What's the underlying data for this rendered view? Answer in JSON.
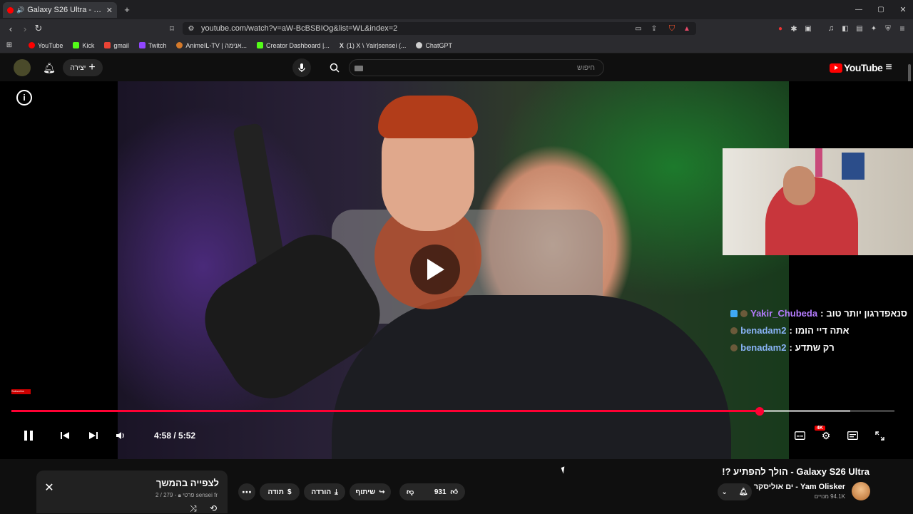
{
  "browser": {
    "tab_title": "Galaxy S26 Ultra - הולך להפתיע ?!",
    "url": "youtube.com/watch?v=aW-BcBSBIOg&list=WL&index=2",
    "bookmarks": [
      {
        "label": "YouTube",
        "color": "#ff0000"
      },
      {
        "label": "Kick",
        "color": "#53fc18"
      },
      {
        "label": "gmail",
        "color": "#ea4335"
      },
      {
        "label": "Twitch",
        "color": "#9146ff"
      },
      {
        "label": "AnimeIL-TV | אנימה...",
        "color": "#d4792a"
      },
      {
        "label": "Creator Dashboard |...",
        "color": "#53fc18"
      },
      {
        "label": "(1) X \\ Yair|sensei (...",
        "color": "#000000"
      },
      {
        "label": "ChatGPT",
        "color": "#cfcfcf"
      }
    ]
  },
  "youtube": {
    "create_label": "יצירה",
    "search_placeholder": "חיפוש",
    "logo_text": "YouTube",
    "logo_color": "#ff0000"
  },
  "player": {
    "current_time": "4:58",
    "duration": "5:52",
    "time_display": "4:58 / 5:52",
    "progress_fraction": 0.847,
    "loaded_fraction": 0.95,
    "quality_badge": "4K",
    "subscribe_tag": "Subscribe",
    "accent_color": "#ff0033"
  },
  "chat": [
    {
      "user": "Yakir_Chubeda",
      "message": "סנאפדרגון יותר טוב",
      "user_color": "#b57cff",
      "badge": "blue"
    },
    {
      "user": "benadam2",
      "message": "אתה דיי הומו",
      "user_color": "#8ab4f8",
      "badge": "gold"
    },
    {
      "user": "benadam2",
      "message": "רק שתדע",
      "user_color": "#8ab4f8",
      "badge": "gold"
    }
  ],
  "video_info": {
    "title": "Galaxy S26 Ultra - הולך להפתיע ?!",
    "channel": "Yam Olisker - ים אוליסקר",
    "subscribers": "94.1K מנויים",
    "likes": "931",
    "share_label": "שיתוף",
    "download_label": "הורדה",
    "thanks_label": "תודה"
  },
  "playlist": {
    "title": "לצפייה בהמשך",
    "owner": "sensei fr",
    "privacy": "פרטי",
    "position": "279 / 2"
  }
}
